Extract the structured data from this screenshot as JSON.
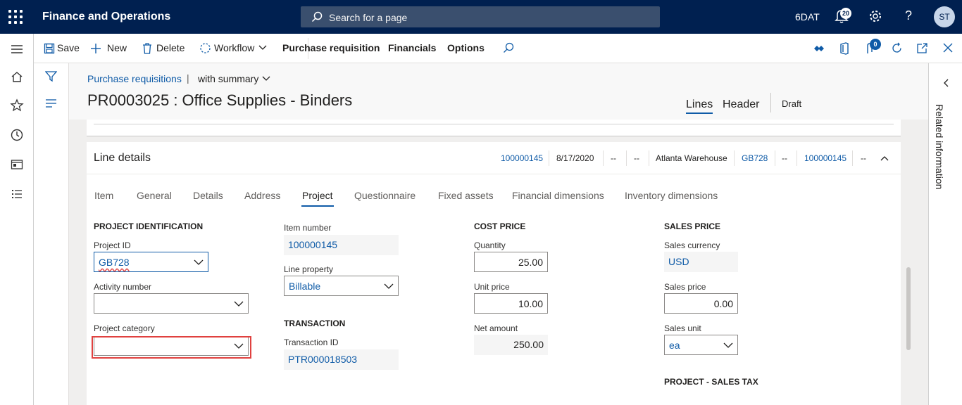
{
  "topbar": {
    "app_title": "Finance and Operations",
    "search_placeholder": "Search for a page",
    "company": "6DAT",
    "notification_count": "20",
    "help_label": "?",
    "avatar_initials": "ST"
  },
  "actions": {
    "save": "Save",
    "new": "New",
    "delete": "Delete",
    "workflow": "Workflow",
    "purchase_requisition": "Purchase requisition",
    "financials": "Financials",
    "options": "Options",
    "office_badge": "0"
  },
  "page": {
    "breadcrumb": "Purchase requisitions",
    "breadcrumb_sep": "|",
    "view": "with summary",
    "title": "PR0003025 : Office Supplies - Binders",
    "view_tabs": [
      "Lines",
      "Header"
    ],
    "status": "Draft"
  },
  "related": {
    "label": "Related information"
  },
  "line_details": {
    "title": "Line details",
    "summary": [
      "100000145",
      "8/17/2020",
      "--",
      "--",
      "Atlanta Warehouse",
      "GB728",
      "--",
      "100000145",
      "--"
    ],
    "tabs": [
      "Item",
      "General",
      "Details",
      "Address",
      "Project",
      "Questionnaire",
      "Fixed assets",
      "Financial dimensions",
      "Inventory dimensions"
    ]
  },
  "project_identification": {
    "heading": "PROJECT IDENTIFICATION",
    "project_id_label": "Project ID",
    "project_id_value": "GB728",
    "activity_label": "Activity number",
    "activity_value": "",
    "category_label": "Project category",
    "category_value": ""
  },
  "item": {
    "item_number_label": "Item number",
    "item_number_value": "100000145",
    "line_property_label": "Line property",
    "line_property_value": "Billable"
  },
  "transaction": {
    "heading": "TRANSACTION",
    "transaction_id_label": "Transaction ID",
    "transaction_id_value": "PTR000018503"
  },
  "cost_price": {
    "heading": "COST PRICE",
    "quantity_label": "Quantity",
    "quantity_value": "25.00",
    "unit_price_label": "Unit price",
    "unit_price_value": "10.00",
    "net_amount_label": "Net amount",
    "net_amount_value": "250.00"
  },
  "sales_price": {
    "heading": "SALES PRICE",
    "currency_label": "Sales currency",
    "currency_value": "USD",
    "sales_price_label": "Sales price",
    "sales_price_value": "0.00",
    "sales_unit_label": "Sales unit",
    "sales_unit_value": "ea"
  },
  "project_sales_tax": {
    "heading": "PROJECT - SALES TAX"
  },
  "colors": {
    "topbar": "#002050",
    "link": "#0f5ba7",
    "highlight": "#e0413f"
  }
}
